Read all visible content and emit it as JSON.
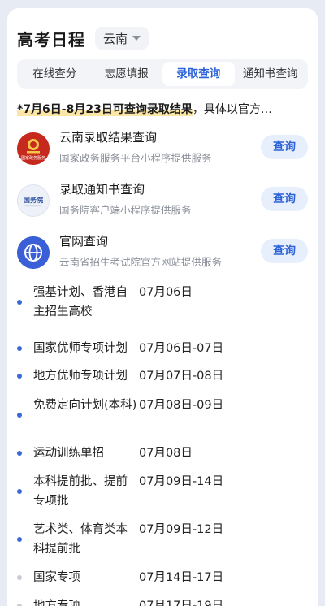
{
  "header": {
    "title": "高考日程",
    "region": "云南"
  },
  "tabs": [
    {
      "label": "在线查分"
    },
    {
      "label": "志愿填报"
    },
    {
      "label": "录取查询",
      "active": true
    },
    {
      "label": "通知书查询"
    }
  ],
  "notice": {
    "highlight": "*7月6日-8月23日可查询录取结果",
    "rest": "，具体以官方…"
  },
  "services": [
    {
      "title": "云南录取结果查询",
      "subtitle": "国家政务服务平台小程序提供服务",
      "button": "查询",
      "icon": "national-emblem-icon",
      "icon_text": "国家政务服务"
    },
    {
      "title": "录取通知书查询",
      "subtitle": "国务院客户端小程序提供服务",
      "button": "查询",
      "icon": "state-council-logo-icon",
      "icon_text": "国务院"
    },
    {
      "title": "官网查询",
      "subtitle": "云南省招生考试院官方网站提供服务",
      "button": "查询",
      "icon": "globe-icon"
    }
  ],
  "schedule": [
    {
      "name": "强基计划、香港自主招生高校",
      "date": "07月06日",
      "status": "active"
    },
    {
      "name": "国家优师专项计划",
      "date": "07月06日-07日",
      "status": "active"
    },
    {
      "name": "地方优师专项计划",
      "date": "07月07日-08日",
      "status": "active"
    },
    {
      "name": "免费定向计划(本科)",
      "date": "07月08日-09日",
      "status": "active"
    },
    {
      "name": "运动训练单招",
      "date": "07月08日",
      "status": "active"
    },
    {
      "name": "本科提前批、提前专项批",
      "date": "07月09日-14日",
      "status": "active"
    },
    {
      "name": "艺术类、体育类本科提前批",
      "date": "07月09日-12日",
      "status": "active"
    },
    {
      "name": "国家专项",
      "date": "07月14日-17日",
      "status": "upcoming"
    },
    {
      "name": "地方专项",
      "date": "07月17日-19日",
      "status": "upcoming"
    }
  ],
  "colors": {
    "accent": "#2d63d8",
    "dot_active": "#3a6ad8",
    "dot_upcoming": "#c8ccd4",
    "highlight": "#fbe6a6"
  }
}
